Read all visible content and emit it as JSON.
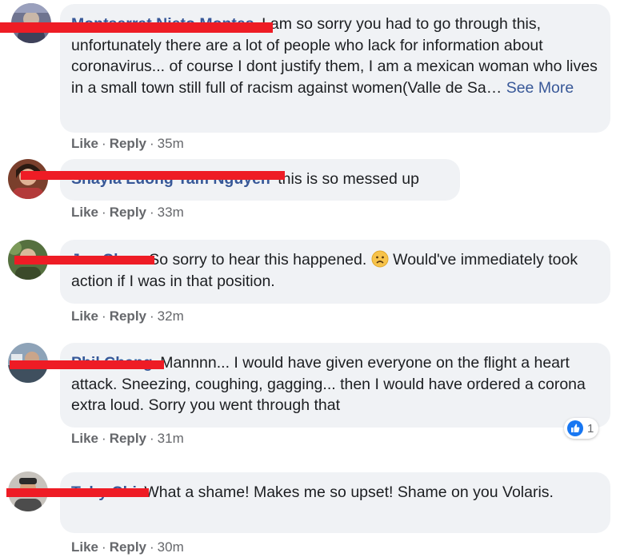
{
  "comments": [
    {
      "author": "Montserrat Nieto Montes",
      "text": "I am so sorry you had to go through this, unfortunately there are a lot of people who lack for information about coronavirus... of course I dont justify them, I am a mexican woman who lives in a small town still full of racism against women(Valle de Sa…",
      "see_more": "See More",
      "like": "Like",
      "reply": "Reply",
      "time": "35m"
    },
    {
      "author": "Shayla Luong Tam Nguyen",
      "text": "this is so messed up",
      "like": "Like",
      "reply": "Reply",
      "time": "33m"
    },
    {
      "author": "Joe Chen",
      "text_before": "So sorry to hear this happened.",
      "text_after": " Would've immediately took action if I was in that position.",
      "like": "Like",
      "reply": "Reply",
      "time": "32m"
    },
    {
      "author": "Phil Chang",
      "text": "Mannnn... I would have given everyone on the flight a heart attack. Sneezing, coughing, gagging... then I would have ordered a corona extra loud. Sorry you went through that",
      "like": "Like",
      "reply": "Reply",
      "time": "31m",
      "reaction_count": "1",
      "reaction_icon": "like-thumb-icon",
      "reaction_color": "#1877f2"
    },
    {
      "author": "Toby Chi",
      "text": "What a shame! Makes me so upset! Shame on you Volaris.",
      "like": "Like",
      "reply": "Reply",
      "time": "30m"
    }
  ],
  "colors": {
    "bubble": "#f0f2f5",
    "link": "#385898",
    "meta": "#65676b",
    "redaction": "#ee1c25"
  }
}
